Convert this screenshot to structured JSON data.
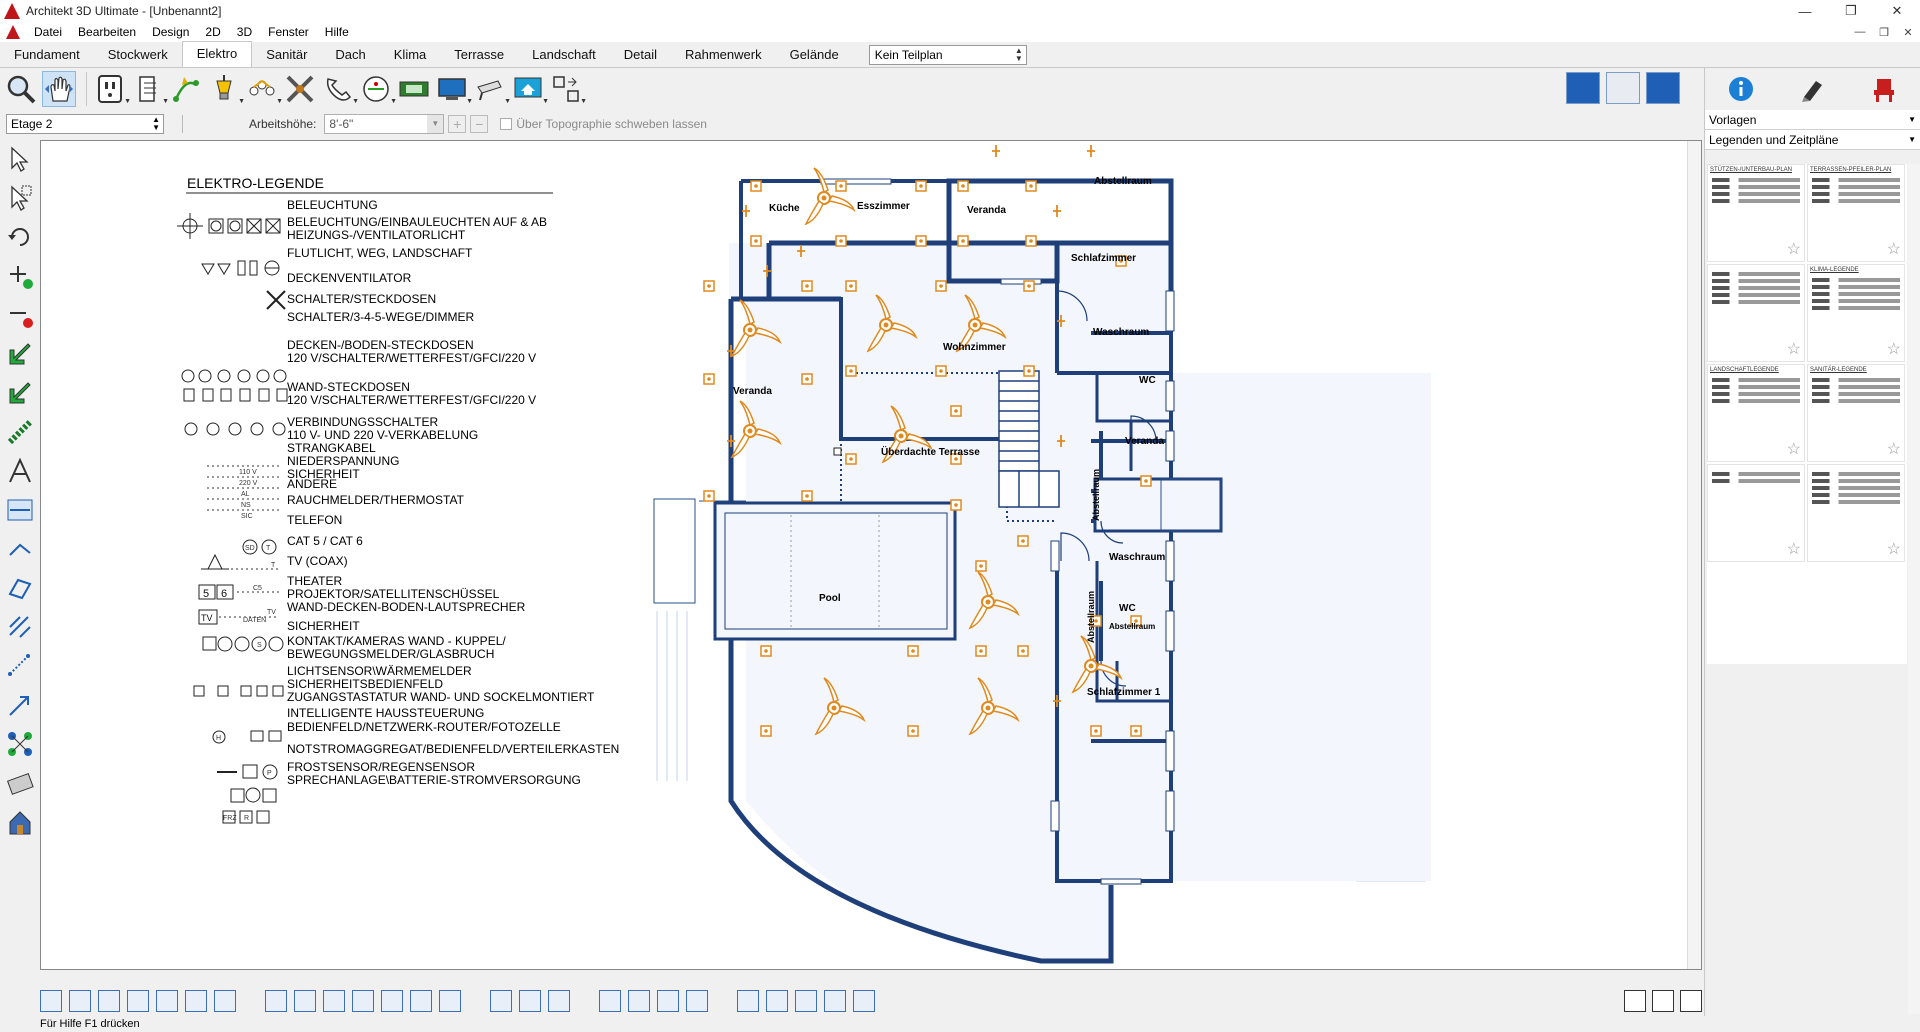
{
  "window": {
    "title": "Architekt 3D Ultimate - [Unbenannt2]",
    "controls": [
      "—",
      "❐",
      "✕"
    ],
    "mdi_controls": [
      "—",
      "❐",
      "✕"
    ]
  },
  "menu": [
    "Datei",
    "Bearbeiten",
    "Design",
    "2D",
    "3D",
    "Fenster",
    "Hilfe"
  ],
  "tabs": [
    "Fundament",
    "Stockwerk",
    "Elektro",
    "Sanitär",
    "Dach",
    "Klima",
    "Terrasse",
    "Landschaft",
    "Detail",
    "Rahmenwerk",
    "Gelände"
  ],
  "active_tab": "Elektro",
  "plan_select": "Kein Teilplan",
  "subbar": {
    "floor": "Etage 2",
    "height_label": "Arbeitshöhe:",
    "height_value": "8'-6\"",
    "checkbox_label": "Über Topographie schweben lassen"
  },
  "legend": {
    "title": "ELEKTRO-LEGENDE",
    "items": [
      "BELEUCHTUNG",
      "BELEUCHTUNG/EINBAULEUCHTEN AUF & AB\nHEIZUNGS-/VENTILATORLICHT",
      "FLUTLICHT, WEG, LANDSCHAFT",
      "DECKENVENTILATOR",
      "SCHALTER/STECKDOSEN",
      "SCHALTER/3-4-5-WEGE/DIMMER",
      "DECKEN-/BODEN-STECKDOSEN\n120 V/SCHALTER/WETTERFEST/GFCI/220 V",
      "WAND-STECKDOSEN\n120 V/SCHALTER/WETTERFEST/GFCI/220 V",
      "VERBINDUNGSSCHALTER\n110 V- UND 220 V-VERKABELUNG\nSTRANGKABEL\nNIEDERSPANNUNG\nSICHERHEIT",
      "ANDERE",
      "RAUCHMELDER/THERMOSTAT",
      "TELEFON",
      "CAT 5 / CAT 6",
      "TV (COAX)",
      "THEATER",
      "PROJEKTOR/SATELLITENSCHÜSSEL\nWAND-DECKEN-BODEN-LAUTSPRECHER",
      "SICHERHEIT",
      "KONTAKT/KAMERAS WAND - KUPPEL/\nBEWEGUNGSMELDER/GLASBRUCH",
      "LICHTSENSOR\\WÄRMEMELDER\nSICHERHEITSBEDIENFELD\nZUGANGSTASTATUR WAND- UND SOCKELMONTIERT",
      "INTELLIGENTE HAUSSTEUERUNG",
      "BEDIENFELD/NETZWERK-ROUTER/FOTOZELLE",
      "NOTSTROMAGGREGAT/BEDIENFELD/VERTEILERKASTEN",
      "FROSTSENSOR/REGENSENSOR\nSPRECHANLAGE\\BATTERIE-STROMVERSORGUNG"
    ],
    "symbol_labels": {
      "line_110": "110 V",
      "line_220": "220 V",
      "line_al": "AL",
      "line_ns": "NS",
      "line_sic": "SIC",
      "tel": "T",
      "cat5": "5",
      "cat6": "6",
      "cat_line": "C5",
      "tv": "TV",
      "tv_line": "TV",
      "daten": "DATEN",
      "sd": "SD",
      "thermo": "T",
      "projector_s": "S",
      "p": "P",
      "h": "H",
      "frz": "FRZ",
      "r": "R"
    }
  },
  "rooms": [
    {
      "name": "Küche"
    },
    {
      "name": "Esszimmer"
    },
    {
      "name": "Veranda"
    },
    {
      "name": "Abstellraum"
    },
    {
      "name": "Schlafzimmer"
    },
    {
      "name": "Waschraum"
    },
    {
      "name": "WC"
    },
    {
      "name": "Wohnzimmer"
    },
    {
      "name": "Veranda"
    },
    {
      "name": "Veranda"
    },
    {
      "name": "Überdachte Terrasse"
    },
    {
      "name": "Abstellraum"
    },
    {
      "name": "Waschraum"
    },
    {
      "name": "Pool"
    },
    {
      "name": "WC"
    },
    {
      "name": "Abstellraum"
    },
    {
      "name": "Abstellraum"
    },
    {
      "name": "Schlafzimmer 1"
    }
  ],
  "right_panel": {
    "dropdown1": "Vorlagen",
    "dropdown2": "Legenden und Zeitpläne",
    "thumbs": [
      "STÜTZEN-/UNTERBAU-PLAN",
      "TERRASSEN-PFEILER-PLAN",
      "",
      "KLIMA-LEGENDE",
      "LANDSCHAFTLEGENDE",
      "SANITÄR-LEGENDE",
      "",
      ""
    ]
  },
  "status": "Für Hilfe F1 drücken",
  "colors": {
    "wall": "#1e3f7a",
    "fixture": "#e08a1e",
    "floor": "#f3f6fc"
  },
  "icons": {
    "search": "search-icon",
    "pan": "pan-hand-icon",
    "outlet": "outlet-icon",
    "info": "info-icon",
    "pen": "pen-icon",
    "chair": "chair-icon"
  }
}
